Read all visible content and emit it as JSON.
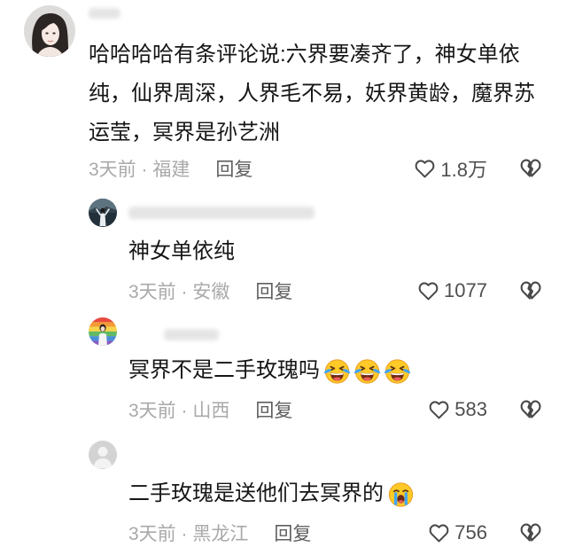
{
  "colors": {
    "background": "#ffffff",
    "text": "#161616",
    "meta": "#a9a9a9",
    "reply": "#5f5f5f",
    "count": "#4f4f4f",
    "icon": "#484848"
  },
  "icons": {
    "like": "heart-outline",
    "dislike": "broken-heart"
  },
  "comment": {
    "text": "哈哈哈哈有条评论说:六界要凑齐了，神女单依纯，仙界周深，人界毛不易，妖界黄龄，魔界苏运莹，冥界是孙艺洲",
    "meta": "3天前 · 福建",
    "reply_label": "回复",
    "likes": "1.8万",
    "replies": [
      {
        "text": "神女单依纯",
        "emoji": [],
        "meta": "3天前 · 安徽",
        "reply_label": "回复",
        "likes": "1077"
      },
      {
        "text": "冥界不是二手玫瑰吗",
        "emoji": [
          "laugh-cry",
          "laugh-cry",
          "laugh-cry"
        ],
        "meta": "3天前 · 山西",
        "reply_label": "回复",
        "likes": "583"
      },
      {
        "text": "二手玫瑰是送他们去冥界的",
        "emoji": [
          "loud-crying"
        ],
        "meta": "3天前 · 黑龙江",
        "reply_label": "回复",
        "likes": "756"
      }
    ]
  }
}
